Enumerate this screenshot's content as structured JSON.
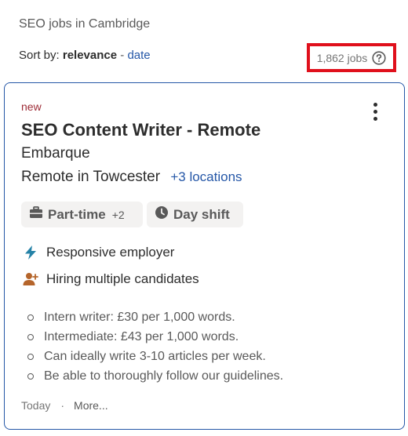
{
  "search_context": "SEO jobs in Cambridge",
  "sort": {
    "prefix": "Sort by:",
    "active": "relevance",
    "separator": "-",
    "alternative": "date"
  },
  "job_count": "1,862 jobs",
  "job": {
    "badge": "new",
    "title": "SEO Content Writer - Remote",
    "company": "Embarque",
    "location": "Remote in Towcester",
    "more_locations": "+3 locations",
    "tags": [
      {
        "icon": "briefcase-icon",
        "label": "Part-time",
        "extra": "+2"
      },
      {
        "icon": "clock-icon",
        "label": "Day shift"
      }
    ],
    "features": [
      {
        "icon": "lightning-icon",
        "label": "Responsive employer"
      },
      {
        "icon": "add-person-icon",
        "label": "Hiring multiple candidates"
      }
    ],
    "snippet": [
      "Intern writer: £30 per 1,000 words.",
      "Intermediate: £43 per 1,000 words.",
      "Can ideally write 3-10 articles per week.",
      "Be able to thoroughly follow our guidelines."
    ],
    "posted": "Today",
    "footer_separator": "·",
    "more_label": "More..."
  },
  "colors": {
    "link": "#2557a7",
    "new_badge": "#9d2b36",
    "highlight_box": "#e0101c",
    "lightning": "#2582a7",
    "person": "#b5652b"
  }
}
